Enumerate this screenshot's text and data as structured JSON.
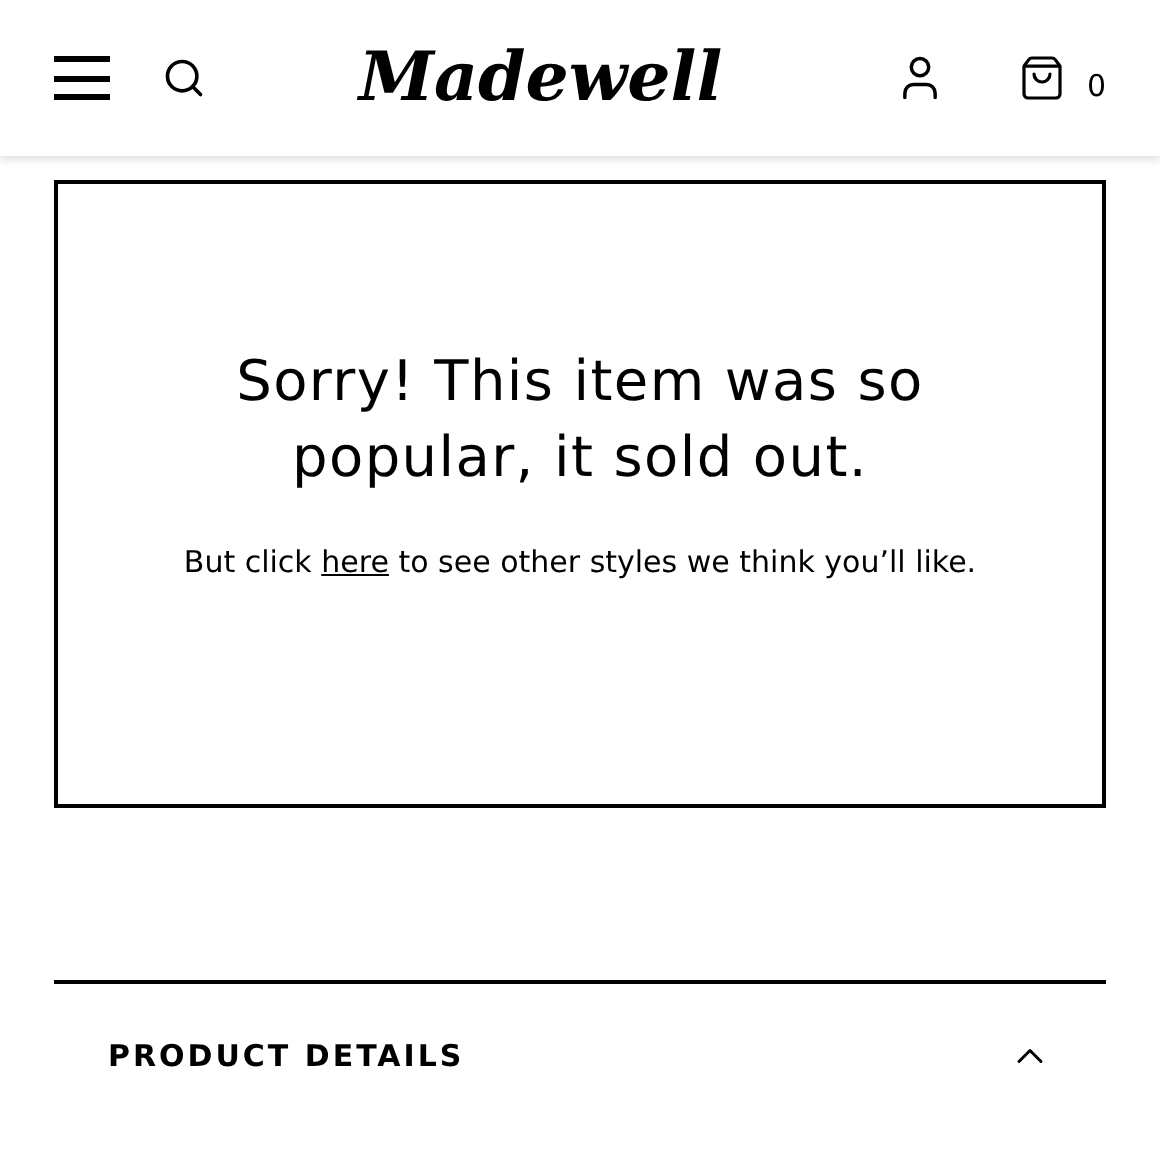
{
  "header": {
    "logo": "Madewell",
    "cart_count": "0"
  },
  "notice": {
    "title": "Sorry! This item was so popular, it sold out.",
    "text_before": "But click ",
    "link": "here",
    "text_after": " to see other styles we think you’ll like."
  },
  "sections": [
    {
      "label": "PRODUCT DETAILS",
      "expanded": true
    }
  ]
}
